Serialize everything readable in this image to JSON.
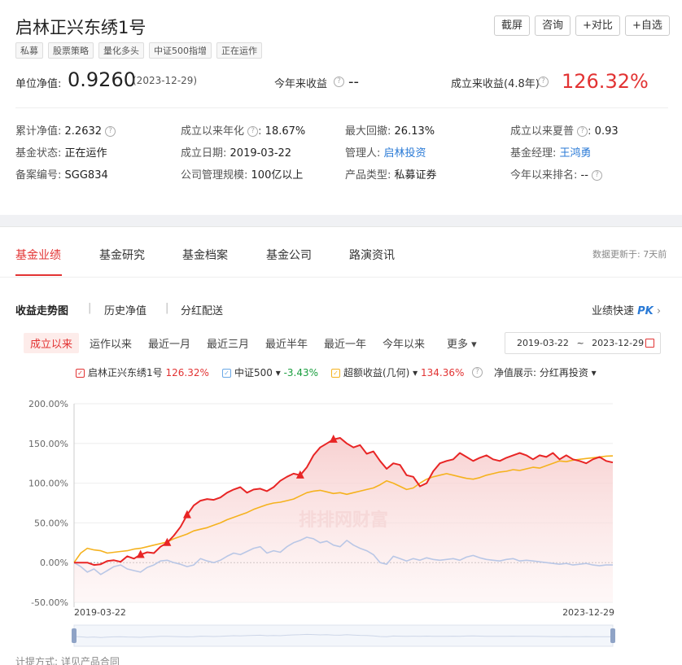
{
  "fund": {
    "name": "启林正兴东绣1号",
    "tags": [
      "私募",
      "股票策略",
      "量化多头",
      "中证500指增",
      "正在运作"
    ]
  },
  "actions": [
    "截屏",
    "咨询",
    "+对比",
    "+自选"
  ],
  "nav": {
    "label": "单位净值:",
    "value": "0.9260",
    "date": "(2023-12-29)",
    "ytd_label": "今年来收益",
    "ytd_value": "--",
    "since_label": "成立来收益(4.8年)",
    "since_value": "126.32%"
  },
  "info": {
    "r1": [
      {
        "k": "累计净值:",
        "v": "2.2632"
      },
      {
        "k": "成立以来年化",
        "v": "18.67%"
      },
      {
        "k": "最大回撤:",
        "v": "26.13%"
      },
      {
        "k": "成立以来夏普",
        "v": "0.93"
      }
    ],
    "r2": [
      {
        "k": "基金状态:",
        "v": "正在运作"
      },
      {
        "k": "成立日期:",
        "v": "2019-03-22"
      },
      {
        "k": "管理人:",
        "v": "启林投资"
      },
      {
        "k": "基金经理:",
        "v": "王鸿勇"
      }
    ],
    "r3": [
      {
        "k": "备案编号:",
        "v": "SGG834"
      },
      {
        "k": "公司管理规模:",
        "v": "100亿以上"
      },
      {
        "k": "产品类型:",
        "v": "私募证券"
      },
      {
        "k": "今年以来排名:",
        "v": "--"
      }
    ]
  },
  "tabs": [
    "基金业绩",
    "基金研究",
    "基金档案",
    "基金公司",
    "路演资讯"
  ],
  "update_note": "数据更新于: 7天前",
  "subtabs": [
    "收益走势图",
    "历史净值",
    "分红配送"
  ],
  "quick": {
    "label": "业绩快速",
    "pk": "PK",
    "arrow": "›"
  },
  "periods": [
    "成立以来",
    "运作以来",
    "最近一月",
    "最近三月",
    "最近半年",
    "最近一年",
    "今年以来",
    "更多 ▾"
  ],
  "date_range": {
    "start": "2019-03-22",
    "sep": "~",
    "end": "2023-12-29"
  },
  "legend": {
    "s1": {
      "name": "启林正兴东绣1号",
      "value": "126.32%"
    },
    "s2": {
      "name": "中证500 ▾",
      "value": "-3.43%"
    },
    "s3": {
      "name": "超额收益(几何) ▾",
      "value": "134.36%"
    },
    "nav_show": "净值展示: 分红再投资 ▾"
  },
  "watermark": "排排网财富",
  "colors": {
    "fund": "#e82525",
    "index": "#b9c7e6",
    "excess": "#f5b21e",
    "accent": "#e23333"
  },
  "chart_data": {
    "type": "line",
    "ylim": [
      -50,
      200
    ],
    "yticks": [
      "200.00%",
      "150.00%",
      "100.00%",
      "50.00%",
      "0.00%",
      "-50.00%"
    ],
    "x_start": "2019-03-22",
    "x_end": "2023-12-29",
    "series": [
      {
        "name": "启林正兴东绣1号",
        "values": [
          0,
          0,
          0,
          -3,
          -2,
          2,
          3,
          1,
          8,
          5,
          10,
          13,
          12,
          20,
          25,
          34,
          45,
          60,
          72,
          78,
          80,
          79,
          82,
          88,
          92,
          95,
          88,
          92,
          93,
          90,
          95,
          103,
          108,
          112,
          110,
          120,
          135,
          145,
          150,
          155,
          157,
          150,
          145,
          148,
          137,
          140,
          128,
          118,
          125,
          123,
          110,
          108,
          96,
          100,
          115,
          125,
          128,
          130,
          138,
          133,
          128,
          132,
          135,
          130,
          128,
          132,
          135,
          138,
          135,
          130,
          135,
          133,
          138,
          130,
          135,
          130,
          128,
          125,
          130,
          133,
          128,
          126
        ]
      },
      {
        "name": "中证500",
        "values": [
          0,
          -5,
          -12,
          -8,
          -15,
          -10,
          -5,
          -3,
          -8,
          -10,
          -12,
          -6,
          -3,
          2,
          3,
          0,
          -2,
          -5,
          -3,
          5,
          2,
          0,
          3,
          8,
          12,
          10,
          14,
          18,
          20,
          12,
          15,
          13,
          20,
          25,
          28,
          32,
          30,
          25,
          27,
          22,
          20,
          28,
          22,
          18,
          15,
          10,
          0,
          -2,
          8,
          5,
          2,
          5,
          3,
          6,
          4,
          3,
          4,
          5,
          3,
          7,
          9,
          6,
          4,
          3,
          2,
          4,
          5,
          2,
          3,
          2,
          1,
          0,
          -1,
          -2,
          -1,
          -3,
          -2,
          -1,
          -3,
          -4,
          -3,
          -3
        ]
      },
      {
        "name": "超额收益(几何)",
        "values": [
          0,
          12,
          18,
          16,
          15,
          12,
          13,
          14,
          15,
          17,
          18,
          20,
          22,
          24,
          26,
          30,
          33,
          36,
          40,
          42,
          44,
          47,
          50,
          54,
          57,
          60,
          63,
          67,
          70,
          73,
          75,
          76,
          78,
          80,
          84,
          88,
          90,
          91,
          89,
          87,
          88,
          86,
          88,
          90,
          92,
          94,
          98,
          103,
          100,
          96,
          92,
          94,
          100,
          105,
          108,
          110,
          112,
          110,
          108,
          106,
          105,
          107,
          110,
          112,
          114,
          115,
          117,
          116,
          118,
          120,
          119,
          122,
          125,
          128,
          127,
          129,
          130,
          131,
          132,
          133,
          134,
          134.36
        ]
      }
    ]
  },
  "footer": "计提方式: 详见产品合同"
}
